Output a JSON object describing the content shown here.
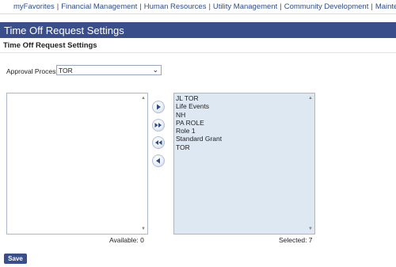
{
  "nav": {
    "items": [
      "myFavorites",
      "Financial Management",
      "Human Resources",
      "Utility Management",
      "Community Development",
      "Maintenance"
    ],
    "separator": "|"
  },
  "page": {
    "title": "Time Off Request Settings",
    "subtitle": "Time Off Request Settings"
  },
  "approval_process": {
    "label": "Approval Process",
    "selected": "TOR"
  },
  "lists": {
    "available": {
      "items": [],
      "count_label": "Available: 0"
    },
    "selected": {
      "items": [
        "JL TOR",
        "Life Events",
        "NH",
        "PA ROLE",
        "Role 1",
        "Standard Grant",
        "TOR"
      ],
      "count_label": "Selected: 7"
    }
  },
  "buttons": {
    "save_label": "Save"
  },
  "colors": {
    "header_bar": "#3b4e8c",
    "selected_list_bg": "#dde8f3",
    "nav_link": "#2f4d8a"
  }
}
